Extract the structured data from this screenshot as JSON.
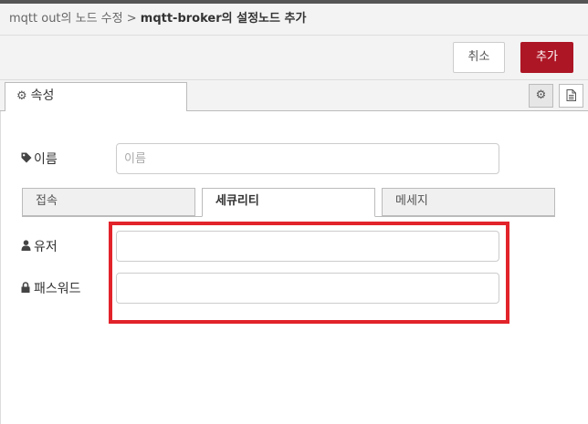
{
  "breadcrumb": {
    "previous": "mqtt out의 노드 수정",
    "separator": " > ",
    "current": "mqtt-broker의 설정노드 추가"
  },
  "toolbar": {
    "cancel_label": "취소",
    "add_label": "추가",
    "add_color": "#ad1625"
  },
  "tabs": {
    "properties_label": "속성"
  },
  "form": {
    "name": {
      "label": "이름",
      "placeholder": "이름",
      "value": ""
    },
    "subtabs": [
      {
        "label": "접속",
        "active": false
      },
      {
        "label": "세큐리티",
        "active": true
      },
      {
        "label": "메세지",
        "active": false
      }
    ],
    "user": {
      "label": "유저",
      "value": ""
    },
    "password": {
      "label": "패스워드",
      "value": ""
    }
  },
  "annotation": {
    "highlight_color": "#e2232a"
  },
  "icons": {
    "tab_properties": "gear-icon",
    "name_field": "tag-icon",
    "user_field": "user-icon",
    "password_field": "lock-icon",
    "settings_button": "gear-icon",
    "description_button": "document-icon"
  }
}
